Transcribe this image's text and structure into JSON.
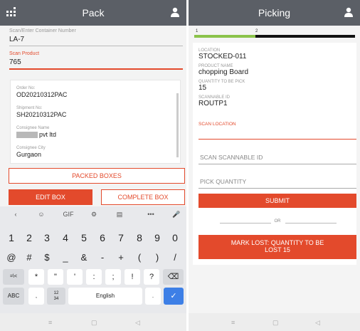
{
  "left": {
    "header": {
      "title": "Pack",
      "menu_icon": "grid-menu-icon",
      "user_icon": "user-icon"
    },
    "scan_container": {
      "label": "Scan/Enter Container Number",
      "value": "LA-7"
    },
    "scan_product": {
      "label": "Scan Product",
      "value": "765"
    },
    "order_info": {
      "order_no_label": "Order No:",
      "order_no": "OD20210312PAC",
      "shipment_no_label": "Shipment No:",
      "shipment_no": "SH20210312PAC",
      "consignee_name_label": "Consignee Name",
      "consignee_name": "pvt ltd",
      "consignee_city_label": "Consignee City",
      "consignee_city": "Gurgaon"
    },
    "buttons": {
      "packed_boxes": "PACKED BOXES",
      "edit_box": "EDIT BOX",
      "complete_box": "COMPLETE BOX"
    },
    "keyboard": {
      "toolbar": [
        "‹",
        "☺",
        "GIF",
        "⚙",
        "▤",
        "•••",
        "🎤"
      ],
      "numbers": [
        "1",
        "2",
        "3",
        "4",
        "5",
        "6",
        "7",
        "8",
        "9",
        "0"
      ],
      "symbols1": [
        "@",
        "#",
        "$",
        "_",
        "&",
        "-",
        "+",
        "(",
        ")",
        "/"
      ],
      "symbols2": [
        "=\\<",
        "*",
        "\"",
        "'",
        ":",
        ";",
        "!",
        "?",
        "⌫"
      ],
      "bottom": {
        "abc": "ABC",
        "comma": ",",
        "fraction": "12\n34",
        "space": "English",
        "dot": ".",
        "enter": "✓"
      }
    },
    "navbar": [
      "≡",
      "▢",
      "◁"
    ]
  },
  "right": {
    "header": {
      "title": "Picking",
      "user_icon": "user-icon"
    },
    "progress": {
      "step1": "1",
      "step2": "2",
      "fraction": 0.38
    },
    "location_label": "LOCATION",
    "location": "STOCKED-011",
    "product_name_label": "PRODUCT NAME",
    "product_name": "chopping Board",
    "quantity_label": "QUANTITY TO BE PICK",
    "quantity": "15",
    "scannable_id_label": "SCANNABLE ID",
    "scannable_id": "ROUTP1",
    "scan_location_label": "SCAN LOCATION",
    "scan_scannable_placeholder": "SCAN SCANNABLE ID",
    "pick_quantity_placeholder": "PICK QUANTITY",
    "submit": "SUBMIT",
    "or": "OR",
    "mark_lost_line1": "MARK LOST: QUANTITY TO BE",
    "mark_lost_line2": "LOST 15",
    "navbar": [
      "≡",
      "▢",
      "◁"
    ]
  },
  "colors": {
    "accent": "#e34a2c",
    "header": "#5b5f66",
    "progress": "#8bc34a"
  }
}
